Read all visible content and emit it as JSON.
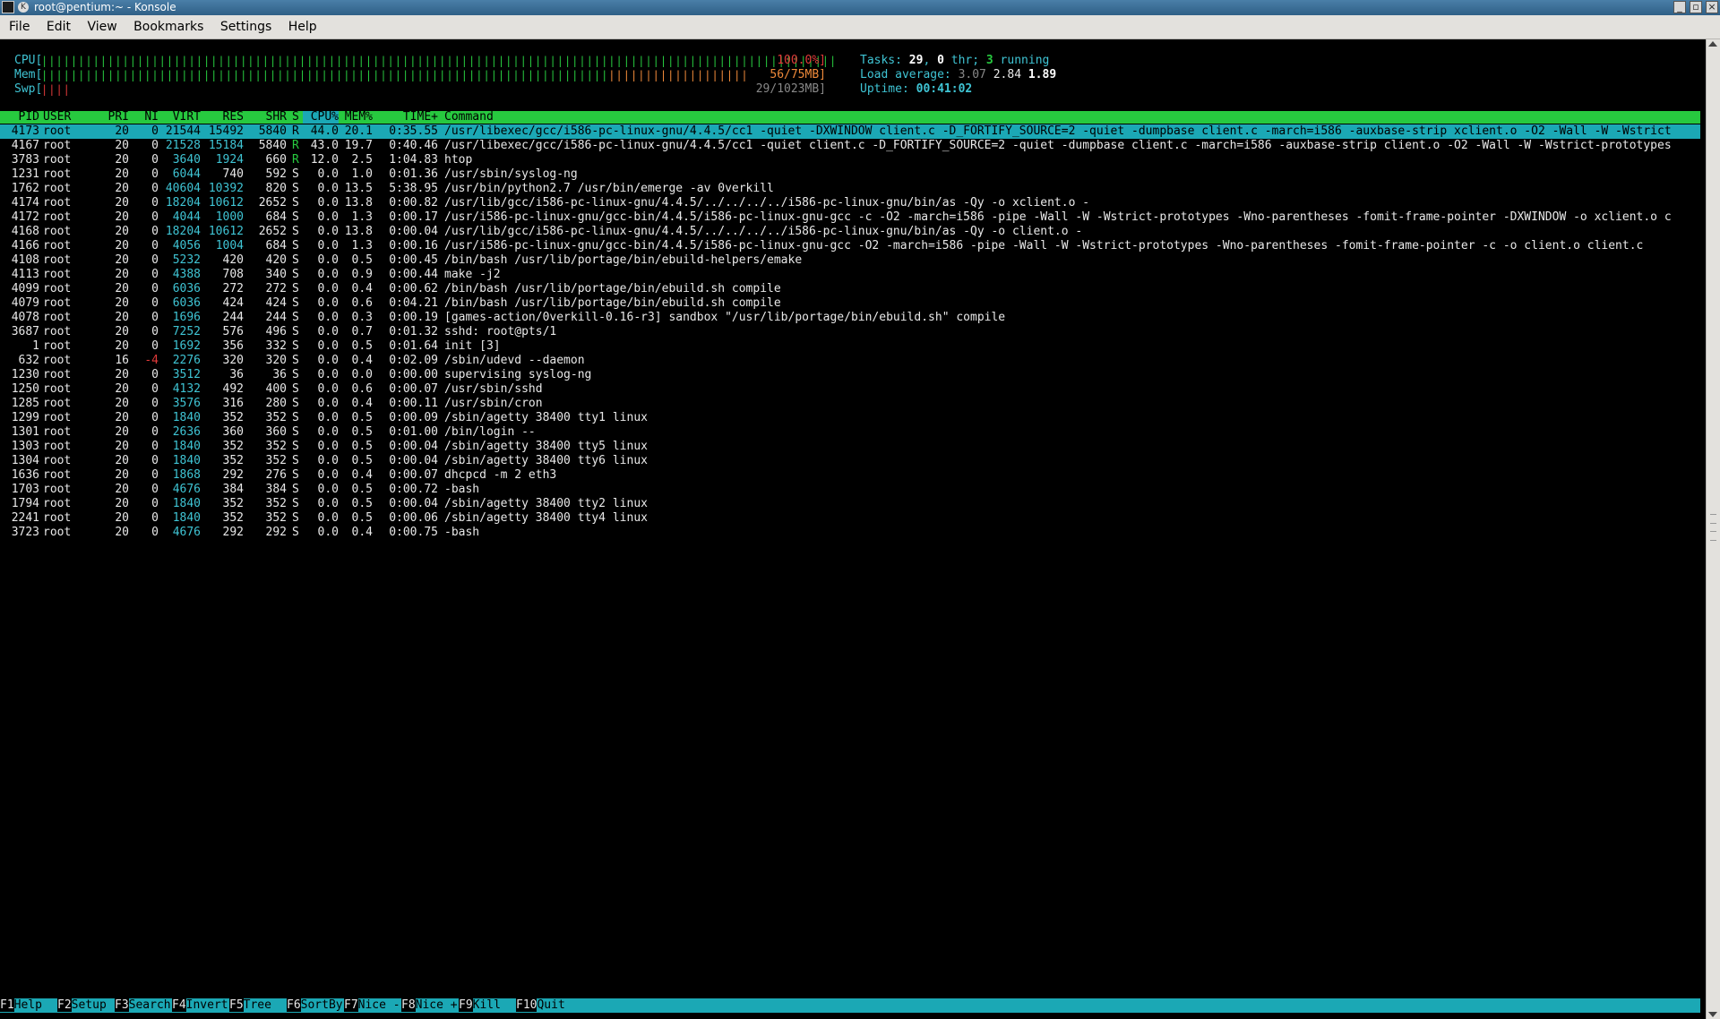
{
  "window": {
    "title": "root@pentium:~ - Konsole"
  },
  "menu": [
    "File",
    "Edit",
    "View",
    "Bookmarks",
    "Settings",
    "Help"
  ],
  "meters": {
    "cpu": {
      "label": "CPU[",
      "value": "100.0%]",
      "fraction": 1.0
    },
    "mem": {
      "label": "Mem[",
      "value": "56/75MB]",
      "fraction": 0.75
    },
    "swp": {
      "label": "Swp[",
      "value": "29/1023MB]",
      "fraction": 0.03
    }
  },
  "sysinfo": {
    "tasks_label": "Tasks: ",
    "tasks": "29",
    "thr_sep": ", ",
    "thr": "0",
    "thr_label": " thr; ",
    "running": "3",
    "running_label": " running",
    "load_label": "Load average: ",
    "load1": "3.07",
    "load5": "2.84",
    "load15": "1.89",
    "uptime_label": "Uptime: ",
    "uptime": "00:41:02"
  },
  "header": {
    "pid": "PID",
    "user": "USER",
    "pri": "PRI",
    "ni": "NI",
    "virt": "VIRT",
    "res": "RES",
    "shr": "SHR",
    "s": "S",
    "cpu": "CPU%",
    "mem": "MEM%",
    "time": "TIME+",
    "command": "Command"
  },
  "processes": [
    {
      "pid": "4173",
      "user": "root",
      "pri": "20",
      "ni": "0",
      "virt": "21544",
      "res": "15492",
      "shr": "5840",
      "s": "R",
      "cpu": "44.0",
      "mem": "20.1",
      "time": "0:35.55",
      "command": "/usr/libexec/gcc/i586-pc-linux-gnu/4.4.5/cc1 -quiet -DXWINDOW client.c -D_FORTIFY_SOURCE=2 -quiet -dumpbase client.c -march=i586 -auxbase-strip xclient.o -O2 -Wall -W -Wstrict"
    },
    {
      "pid": "4167",
      "user": "root",
      "pri": "20",
      "ni": "0",
      "virt": "21528",
      "res": "15184",
      "shr": "5840",
      "s": "R",
      "cpu": "43.0",
      "mem": "19.7",
      "time": "0:40.46",
      "command": "/usr/libexec/gcc/i586-pc-linux-gnu/4.4.5/cc1 -quiet client.c -D_FORTIFY_SOURCE=2 -quiet -dumpbase client.c -march=i586 -auxbase-strip client.o -O2 -Wall -W -Wstrict-prototypes"
    },
    {
      "pid": "3783",
      "user": "root",
      "pri": "20",
      "ni": "0",
      "virt": "3640",
      "res": "1924",
      "shr": "660",
      "s": "R",
      "cpu": "12.0",
      "mem": "2.5",
      "time": "1:04.83",
      "command": "htop"
    },
    {
      "pid": "1231",
      "user": "root",
      "pri": "20",
      "ni": "0",
      "virt": "6044",
      "res": "740",
      "shr": "592",
      "s": "S",
      "cpu": "0.0",
      "mem": "1.0",
      "time": "0:01.36",
      "command": "/usr/sbin/syslog-ng"
    },
    {
      "pid": "1762",
      "user": "root",
      "pri": "20",
      "ni": "0",
      "virt": "40604",
      "res": "10392",
      "shr": "820",
      "s": "S",
      "cpu": "0.0",
      "mem": "13.5",
      "time": "5:38.95",
      "command": "/usr/bin/python2.7 /usr/bin/emerge -av 0verkill"
    },
    {
      "pid": "4174",
      "user": "root",
      "pri": "20",
      "ni": "0",
      "virt": "18204",
      "res": "10612",
      "shr": "2652",
      "s": "S",
      "cpu": "0.0",
      "mem": "13.8",
      "time": "0:00.82",
      "command": "/usr/lib/gcc/i586-pc-linux-gnu/4.4.5/../../../../i586-pc-linux-gnu/bin/as -Qy -o xclient.o -"
    },
    {
      "pid": "4172",
      "user": "root",
      "pri": "20",
      "ni": "0",
      "virt": "4044",
      "res": "1000",
      "shr": "684",
      "s": "S",
      "cpu": "0.0",
      "mem": "1.3",
      "time": "0:00.17",
      "command": "/usr/i586-pc-linux-gnu/gcc-bin/4.4.5/i586-pc-linux-gnu-gcc -c -O2 -march=i586 -pipe -Wall -W -Wstrict-prototypes -Wno-parentheses -fomit-frame-pointer -DXWINDOW -o xclient.o c"
    },
    {
      "pid": "4168",
      "user": "root",
      "pri": "20",
      "ni": "0",
      "virt": "18204",
      "res": "10612",
      "shr": "2652",
      "s": "S",
      "cpu": "0.0",
      "mem": "13.8",
      "time": "0:00.04",
      "command": "/usr/lib/gcc/i586-pc-linux-gnu/4.4.5/../../../../i586-pc-linux-gnu/bin/as -Qy -o client.o -"
    },
    {
      "pid": "4166",
      "user": "root",
      "pri": "20",
      "ni": "0",
      "virt": "4056",
      "res": "1004",
      "shr": "684",
      "s": "S",
      "cpu": "0.0",
      "mem": "1.3",
      "time": "0:00.16",
      "command": "/usr/i586-pc-linux-gnu/gcc-bin/4.4.5/i586-pc-linux-gnu-gcc -O2 -march=i586 -pipe -Wall -W -Wstrict-prototypes -Wno-parentheses -fomit-frame-pointer -c -o client.o client.c"
    },
    {
      "pid": "4108",
      "user": "root",
      "pri": "20",
      "ni": "0",
      "virt": "5232",
      "res": "420",
      "shr": "420",
      "s": "S",
      "cpu": "0.0",
      "mem": "0.5",
      "time": "0:00.45",
      "command": "/bin/bash /usr/lib/portage/bin/ebuild-helpers/emake"
    },
    {
      "pid": "4113",
      "user": "root",
      "pri": "20",
      "ni": "0",
      "virt": "4388",
      "res": "708",
      "shr": "340",
      "s": "S",
      "cpu": "0.0",
      "mem": "0.9",
      "time": "0:00.44",
      "command": "make -j2"
    },
    {
      "pid": "4099",
      "user": "root",
      "pri": "20",
      "ni": "0",
      "virt": "6036",
      "res": "272",
      "shr": "272",
      "s": "S",
      "cpu": "0.0",
      "mem": "0.4",
      "time": "0:00.62",
      "command": "/bin/bash /usr/lib/portage/bin/ebuild.sh compile"
    },
    {
      "pid": "4079",
      "user": "root",
      "pri": "20",
      "ni": "0",
      "virt": "6036",
      "res": "424",
      "shr": "424",
      "s": "S",
      "cpu": "0.0",
      "mem": "0.6",
      "time": "0:04.21",
      "command": "/bin/bash /usr/lib/portage/bin/ebuild.sh compile"
    },
    {
      "pid": "4078",
      "user": "root",
      "pri": "20",
      "ni": "0",
      "virt": "1696",
      "res": "244",
      "shr": "244",
      "s": "S",
      "cpu": "0.0",
      "mem": "0.3",
      "time": "0:00.19",
      "command": "[games-action/0verkill-0.16-r3] sandbox \"/usr/lib/portage/bin/ebuild.sh\" compile"
    },
    {
      "pid": "3687",
      "user": "root",
      "pri": "20",
      "ni": "0",
      "virt": "7252",
      "res": "576",
      "shr": "496",
      "s": "S",
      "cpu": "0.0",
      "mem": "0.7",
      "time": "0:01.32",
      "command": "sshd: root@pts/1"
    },
    {
      "pid": "1",
      "user": "root",
      "pri": "20",
      "ni": "0",
      "virt": "1692",
      "res": "356",
      "shr": "332",
      "s": "S",
      "cpu": "0.0",
      "mem": "0.5",
      "time": "0:01.64",
      "command": "init [3]"
    },
    {
      "pid": "632",
      "user": "root",
      "pri": "16",
      "ni": "-4",
      "virt": "2276",
      "res": "320",
      "shr": "320",
      "s": "S",
      "cpu": "0.0",
      "mem": "0.4",
      "time": "0:02.09",
      "command": "/sbin/udevd --daemon"
    },
    {
      "pid": "1230",
      "user": "root",
      "pri": "20",
      "ni": "0",
      "virt": "3512",
      "res": "36",
      "shr": "36",
      "s": "S",
      "cpu": "0.0",
      "mem": "0.0",
      "time": "0:00.00",
      "command": "supervising syslog-ng"
    },
    {
      "pid": "1250",
      "user": "root",
      "pri": "20",
      "ni": "0",
      "virt": "4132",
      "res": "492",
      "shr": "400",
      "s": "S",
      "cpu": "0.0",
      "mem": "0.6",
      "time": "0:00.07",
      "command": "/usr/sbin/sshd"
    },
    {
      "pid": "1285",
      "user": "root",
      "pri": "20",
      "ni": "0",
      "virt": "3576",
      "res": "316",
      "shr": "280",
      "s": "S",
      "cpu": "0.0",
      "mem": "0.4",
      "time": "0:00.11",
      "command": "/usr/sbin/cron"
    },
    {
      "pid": "1299",
      "user": "root",
      "pri": "20",
      "ni": "0",
      "virt": "1840",
      "res": "352",
      "shr": "352",
      "s": "S",
      "cpu": "0.0",
      "mem": "0.5",
      "time": "0:00.09",
      "command": "/sbin/agetty 38400 tty1 linux"
    },
    {
      "pid": "1301",
      "user": "root",
      "pri": "20",
      "ni": "0",
      "virt": "2636",
      "res": "360",
      "shr": "360",
      "s": "S",
      "cpu": "0.0",
      "mem": "0.5",
      "time": "0:01.00",
      "command": "/bin/login --"
    },
    {
      "pid": "1303",
      "user": "root",
      "pri": "20",
      "ni": "0",
      "virt": "1840",
      "res": "352",
      "shr": "352",
      "s": "S",
      "cpu": "0.0",
      "mem": "0.5",
      "time": "0:00.04",
      "command": "/sbin/agetty 38400 tty5 linux"
    },
    {
      "pid": "1304",
      "user": "root",
      "pri": "20",
      "ni": "0",
      "virt": "1840",
      "res": "352",
      "shr": "352",
      "s": "S",
      "cpu": "0.0",
      "mem": "0.5",
      "time": "0:00.04",
      "command": "/sbin/agetty 38400 tty6 linux"
    },
    {
      "pid": "1636",
      "user": "root",
      "pri": "20",
      "ni": "0",
      "virt": "1868",
      "res": "292",
      "shr": "276",
      "s": "S",
      "cpu": "0.0",
      "mem": "0.4",
      "time": "0:00.07",
      "command": "dhcpcd -m 2 eth3"
    },
    {
      "pid": "1703",
      "user": "root",
      "pri": "20",
      "ni": "0",
      "virt": "4676",
      "res": "384",
      "shr": "384",
      "s": "S",
      "cpu": "0.0",
      "mem": "0.5",
      "time": "0:00.72",
      "command": "-bash"
    },
    {
      "pid": "1794",
      "user": "root",
      "pri": "20",
      "ni": "0",
      "virt": "1840",
      "res": "352",
      "shr": "352",
      "s": "S",
      "cpu": "0.0",
      "mem": "0.5",
      "time": "0:00.04",
      "command": "/sbin/agetty 38400 tty2 linux"
    },
    {
      "pid": "2241",
      "user": "root",
      "pri": "20",
      "ni": "0",
      "virt": "1840",
      "res": "352",
      "shr": "352",
      "s": "S",
      "cpu": "0.0",
      "mem": "0.5",
      "time": "0:00.06",
      "command": "/sbin/agetty 38400 tty4 linux"
    },
    {
      "pid": "3723",
      "user": "root",
      "pri": "20",
      "ni": "0",
      "virt": "4676",
      "res": "292",
      "shr": "292",
      "s": "S",
      "cpu": "0.0",
      "mem": "0.4",
      "time": "0:00.75",
      "command": "-bash"
    }
  ],
  "fkeys": [
    {
      "key": "F1",
      "label": "Help  "
    },
    {
      "key": "F2",
      "label": "Setup "
    },
    {
      "key": "F3",
      "label": "Search"
    },
    {
      "key": "F4",
      "label": "Invert"
    },
    {
      "key": "F5",
      "label": "Tree  "
    },
    {
      "key": "F6",
      "label": "SortBy"
    },
    {
      "key": "F7",
      "label": "Nice -"
    },
    {
      "key": "F8",
      "label": "Nice +"
    },
    {
      "key": "F9",
      "label": "Kill  "
    },
    {
      "key": "F10",
      "label": "Quit  "
    }
  ],
  "colors": {
    "cyan": "#3fc4d4",
    "green": "#27c93f",
    "selected": "#1ba8b5",
    "red": "#e03a3a",
    "orange": "#f08a3a"
  }
}
